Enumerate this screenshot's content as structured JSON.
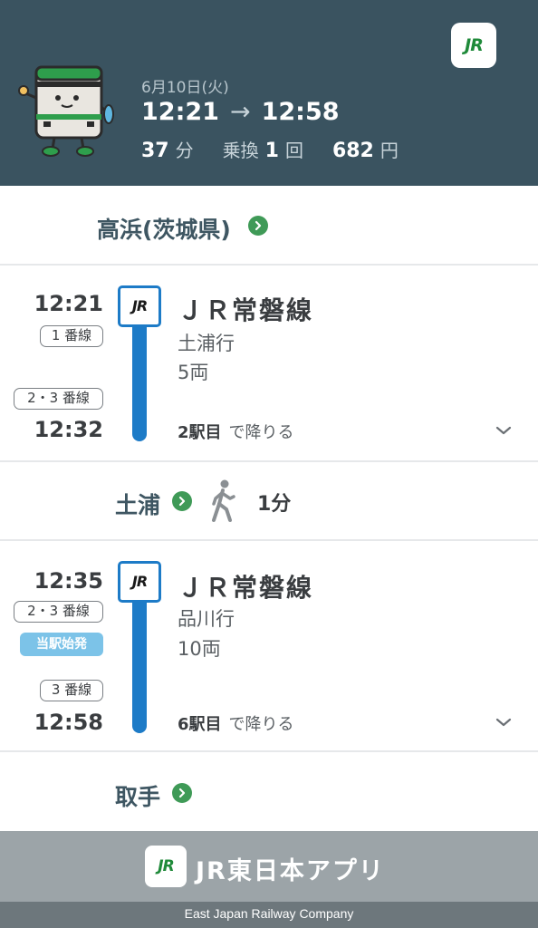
{
  "header": {
    "date": "6月10日(火)",
    "depart_time": "12:21",
    "arrow": "→",
    "arrive_time": "12:58",
    "duration_value": "37",
    "duration_unit": "分",
    "transfer_label": "乗換",
    "transfer_value": "1",
    "transfer_unit": "回",
    "fare_value": "682",
    "fare_unit": "円",
    "badge": "JR",
    "bg_color": "#3a5360"
  },
  "stations": {
    "origin": "高浜(茨城県)",
    "transfer": "土浦",
    "destination": "取手"
  },
  "transfer_walk": {
    "time": "1分"
  },
  "segments": [
    {
      "depart_time": "12:21",
      "depart_platform": "1 番線",
      "arrive_platform": "2・3 番線",
      "arrive_time": "12:32",
      "line_badge": "JR",
      "line_name": "ＪＲ常磐線",
      "destination": "土浦行",
      "cars": "5両",
      "stops_count": "2駅目",
      "stops_suffix": "で降りる",
      "line_color": "#1d7bc7"
    },
    {
      "depart_time": "12:35",
      "depart_platform": "2・3 番線",
      "origin_badge": "当駅始発",
      "arrive_platform": "3 番線",
      "arrive_time": "12:58",
      "line_badge": "JR",
      "line_name": "ＪＲ常磐線",
      "destination": "品川行",
      "cars": "10両",
      "stops_count": "6駅目",
      "stops_suffix": "で降りる",
      "line_color": "#1d7bc7"
    }
  ],
  "footer": {
    "logo": "JR",
    "app_name": "JR東日本アプリ",
    "company": "East Japan Railway Company"
  },
  "icons": {
    "go": "chevron-right-circle-icon",
    "walk": "walking-person-icon",
    "expand": "chevron-down-icon",
    "mascot": "train-mascot-icon"
  }
}
